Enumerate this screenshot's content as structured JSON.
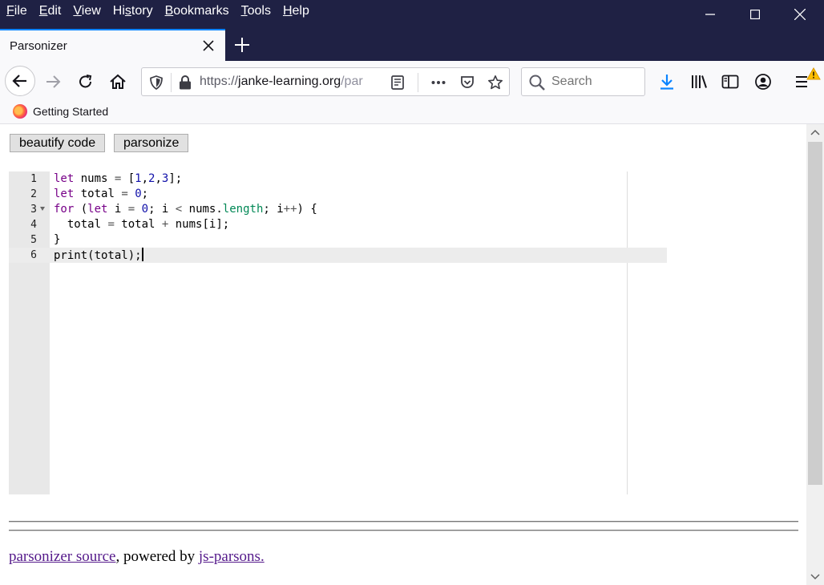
{
  "menu": [
    "File",
    "Edit",
    "View",
    "History",
    "Bookmarks",
    "Tools",
    "Help"
  ],
  "menu_accel": [
    "F",
    "E",
    "V",
    "s",
    "B",
    "T",
    "H"
  ],
  "tab": {
    "title": "Parsonizer"
  },
  "url": {
    "scheme": "https://",
    "host": "janke-learning.org",
    "rest": "/par"
  },
  "search": {
    "placeholder": "Search"
  },
  "bookmarks": [
    {
      "label": "Getting Started"
    }
  ],
  "buttons": {
    "beautify": "beautify code",
    "parsonize": "parsonize"
  },
  "editor": {
    "line_numbers": [
      "1",
      "2",
      "3",
      "4",
      "5",
      "6"
    ],
    "lines": [
      "let nums = [1,2,3];",
      "let total = 0;",
      "for (let i = 0; i < nums.length; i++) {",
      "  total = total + nums[i];",
      "}",
      "print(total);"
    ],
    "active_line": 6
  },
  "footer": {
    "source_link": "parsonizer source",
    "middle_text": ", powered by ",
    "parsons_link": "js-parsons."
  },
  "colors": {
    "titlebar": "#1f2144",
    "tab_accent": "#0a84ff",
    "link": "#551a8b",
    "keyword": "#770088",
    "download_icon": "#0a84ff",
    "warning": "#ffbf00"
  }
}
